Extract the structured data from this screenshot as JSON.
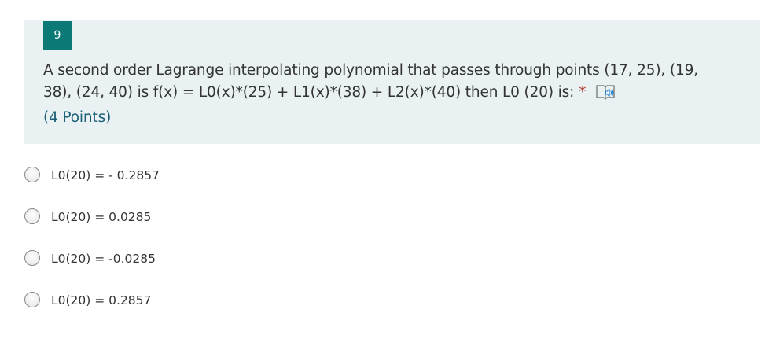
{
  "question": {
    "number": "9",
    "line1": "A second order Lagrange interpolating polynomial that passes through points (17, 25), (19,",
    "line2": "38), (24, 40) is f(x) = L0(x)*(25) + L1(x)*(38) + L2(x)*(40) then L0 (20) is:",
    "required_mark": "*",
    "points": "(4 Points)",
    "icons": {
      "reader": "immersive-reader-icon"
    },
    "colors": {
      "card_background": "#e9f1f3",
      "number_badge": "#0b7a76",
      "required_star": "#b03a2e",
      "points_text": "#1c5f76"
    }
  },
  "options": [
    {
      "label": "L0(20) = - 0.2857",
      "selected": false
    },
    {
      "label": "L0(20) = 0.0285",
      "selected": false
    },
    {
      "label": "L0(20) = -0.0285",
      "selected": false
    },
    {
      "label": "L0(20) = 0.2857",
      "selected": false
    }
  ]
}
